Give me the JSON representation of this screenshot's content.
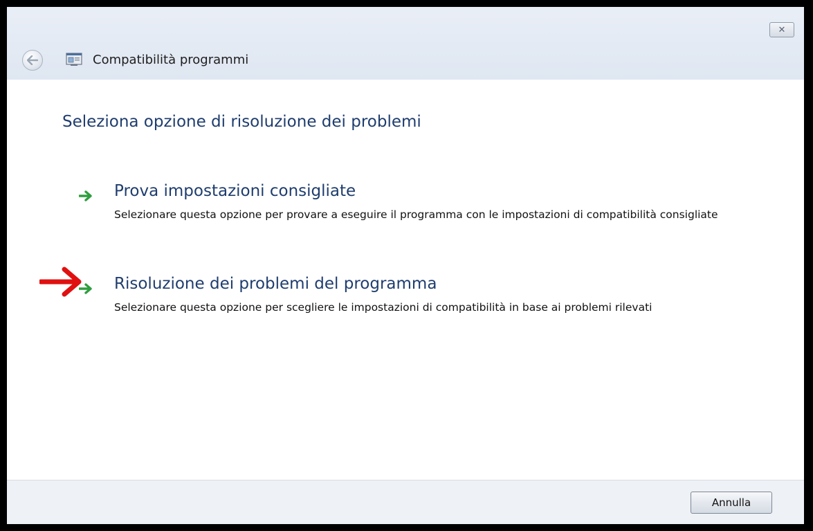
{
  "window": {
    "close_glyph": "✕",
    "title": "Compatibilità programmi"
  },
  "page": {
    "heading": "Seleziona opzione di risoluzione dei problemi"
  },
  "options": [
    {
      "title": "Prova impostazioni consigliate",
      "description": "Selezionare questa opzione per provare a eseguire il programma con le impostazioni di compatibilità consigliate",
      "icon": "green-arrow-icon"
    },
    {
      "title": "Risoluzione dei problemi del programma",
      "description": "Selezionare questa opzione per scegliere le impostazioni di compatibilità in base ai problemi rilevati",
      "icon": "green-arrow-icon",
      "highlighted": true
    }
  ],
  "footer": {
    "cancel_label": "Annulla"
  },
  "colors": {
    "heading": "#1f3d6e",
    "link_arrow": "#2e9e3e",
    "annotation_arrow": "#e01010"
  }
}
